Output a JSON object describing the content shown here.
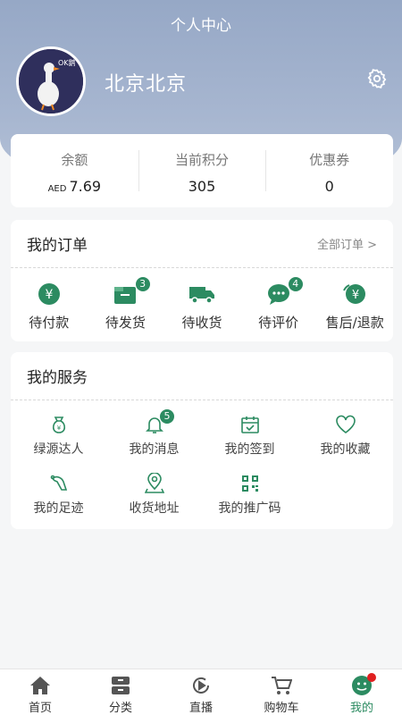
{
  "header": {
    "title": "个人中心",
    "username": "北京北京",
    "avatar_text": "OK鹅"
  },
  "wallet": [
    {
      "label": "余额",
      "currency": "AED",
      "value": "7.69"
    },
    {
      "label": "当前积分",
      "value": "305"
    },
    {
      "label": "优惠券",
      "value": "0"
    }
  ],
  "orders": {
    "title": "我的订单",
    "more": "全部订单 >",
    "items": [
      {
        "label": "待付款",
        "icon": "yuan-coin-icon"
      },
      {
        "label": "待发货",
        "icon": "box-icon",
        "badge": "3"
      },
      {
        "label": "待收货",
        "icon": "truck-icon"
      },
      {
        "label": "待评价",
        "icon": "comment-icon",
        "badge": "4"
      },
      {
        "label": "售后/退款",
        "icon": "refund-icon"
      }
    ]
  },
  "services": {
    "title": "我的服务",
    "items": [
      {
        "label": "绿源达人",
        "icon": "money-bag-icon"
      },
      {
        "label": "我的消息",
        "icon": "bell-icon",
        "badge": "5"
      },
      {
        "label": "我的签到",
        "icon": "calendar-check-icon"
      },
      {
        "label": "我的收藏",
        "icon": "heart-icon"
      },
      {
        "label": "我的足迹",
        "icon": "footprint-icon"
      },
      {
        "label": "收货地址",
        "icon": "location-icon"
      },
      {
        "label": "我的推广码",
        "icon": "qrcode-icon"
      }
    ]
  },
  "tabbar": [
    {
      "label": "首页",
      "icon": "home-icon"
    },
    {
      "label": "分类",
      "icon": "category-icon"
    },
    {
      "label": "直播",
      "icon": "live-icon"
    },
    {
      "label": "购物车",
      "icon": "cart-icon"
    },
    {
      "label": "我的",
      "icon": "profile-icon",
      "active": true
    }
  ],
  "colors": {
    "accent": "#2c8b61",
    "header": "#a4b4cf",
    "badge_dot": "#e02020"
  }
}
